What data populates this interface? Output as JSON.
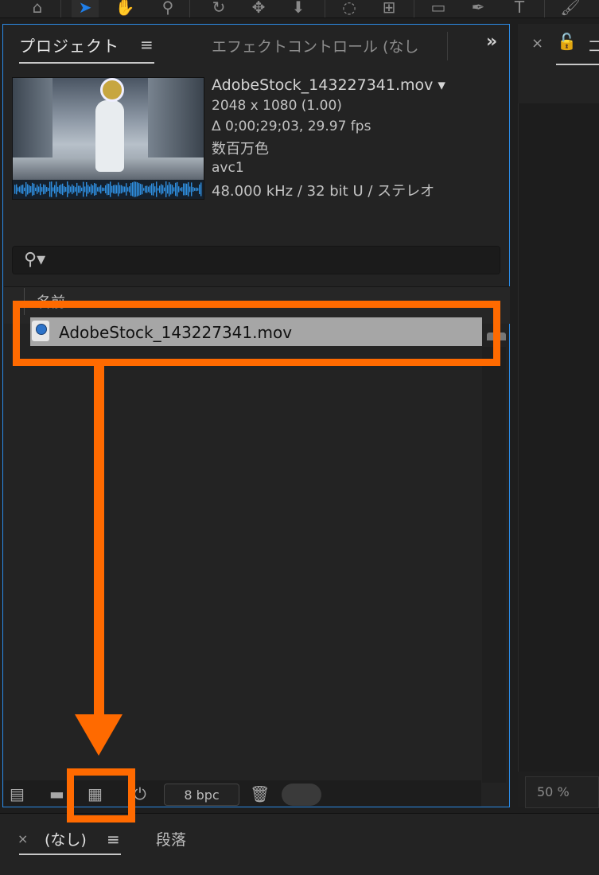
{
  "toolbar": {
    "tools": [
      "home-icon",
      "selection-tool-icon",
      "hand-tool-icon",
      "zoom-tool-icon",
      "orbit-icon",
      "pan-icon",
      "dolly-icon",
      "rotation-icon",
      "anchor-icon",
      "rectangle-icon",
      "pen-icon",
      "type-icon",
      "brush-icon"
    ],
    "selected_tool": "selection-tool-icon"
  },
  "project_panel": {
    "tab_project": "プロジェクト",
    "tab_effects": "エフェクトコントロール (なし",
    "overflow": "»",
    "menu_glyph": "≡",
    "file": {
      "name": "AdobeStock_143227341.mov ▾",
      "resolution": "2048 x 1080 (1.00)",
      "duration": "Δ 0;00;29;03, 29.97 fps",
      "color": "数百万色",
      "codec": "avc1",
      "audio": "48.000 kHz / 32 bit U / ステレオ"
    },
    "search": {
      "placeholder": "",
      "icon_glyph": "⚲▾"
    },
    "list": {
      "column_name": "名前",
      "items": [
        {
          "name": "AdobeStock_143227341.mov"
        }
      ]
    },
    "bottom": {
      "bpc": "8 bpc",
      "icons": [
        "interpret-footage-icon",
        "new-folder-icon",
        "new-composition-icon",
        "flowchart-icon",
        "trash-icon"
      ]
    }
  },
  "right_panel": {
    "tab_fragment": "コ",
    "zoom": "50 %",
    "close_glyph": "×",
    "lock_glyph": "🔓"
  },
  "lower_panel": {
    "tab_none": "(なし)",
    "tab_paragraph": "段落",
    "close_glyph": "×",
    "menu_glyph": "≡"
  },
  "colors": {
    "accent_orange": "#ff6a00",
    "panel_focus_border": "#2b8be6",
    "waveform_blue": "#2f8fe0"
  }
}
